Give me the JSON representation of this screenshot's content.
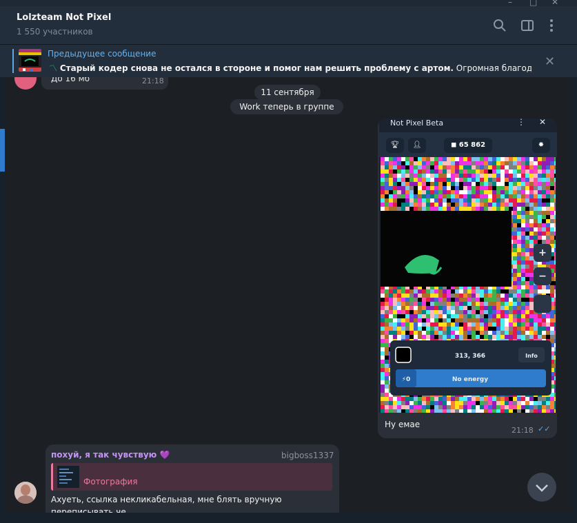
{
  "window": {
    "controls": [
      "–",
      "□",
      "✕"
    ]
  },
  "header": {
    "title": "Lolzteam Not Pixel",
    "subtitle": "1 550 участников",
    "icons": [
      "search-icon",
      "sidebar-toggle-icon",
      "more-vertical-icon"
    ]
  },
  "pinned": {
    "title": "Предыдущее сообщение",
    "text_bold": "Старый кодер снова не остался в стороне и помог нам решить проблему с артом.",
    "text_rest": " Огромная благодар..."
  },
  "messages": {
    "top": {
      "text": "До 16 мб",
      "time": "21:18"
    },
    "date_separator": "11 сентября",
    "service": "Work теперь в группе",
    "image_message": {
      "screenshot": {
        "title": "Not Pixel Beta",
        "balance": "65 862",
        "coords": "313, 366",
        "info_label": "Info",
        "energy_count": "0",
        "energy_label": "No energy"
      },
      "caption": "Ну емае",
      "time": "21:18"
    },
    "bottom": {
      "sender": "похуй, я так чувствую",
      "sender_emoji": "💜",
      "tag": "bigboss1337",
      "reply_label": "Фотография",
      "text": "Ахуеть, ссылка некликабельная, мне блять вручную переписывать че"
    }
  },
  "colors": {
    "accent": "#5fa7e4",
    "sender": "#c591f5",
    "reply": "#e97b9d",
    "bubble": "#2b3038"
  }
}
